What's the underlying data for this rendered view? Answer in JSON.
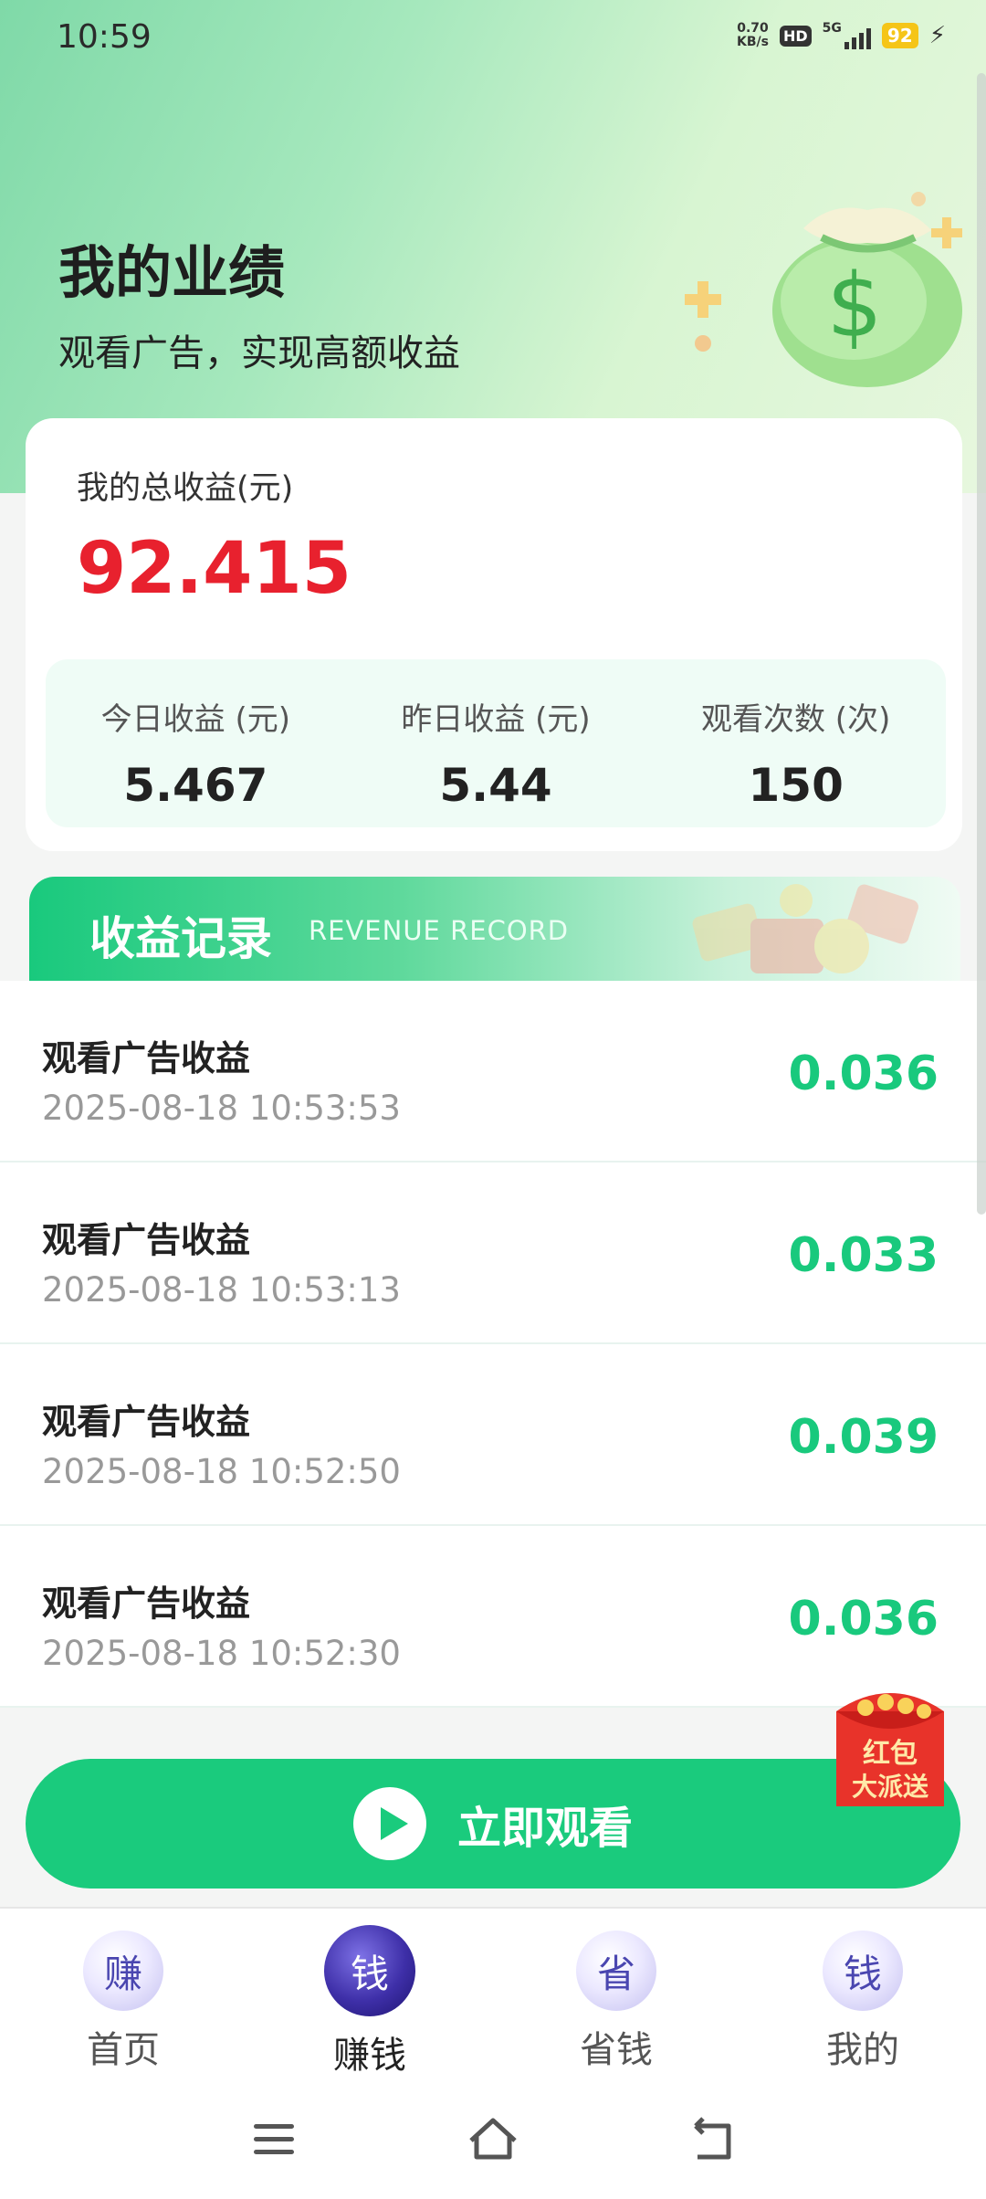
{
  "status_bar": {
    "time": "10:59",
    "net_speed_value": "0.70",
    "net_speed_unit": "KB/s",
    "hd": "HD",
    "network": "5G",
    "battery": "92"
  },
  "hero": {
    "title": "我的业绩",
    "subtitle": "观看广告，实现高额收益"
  },
  "summary": {
    "total_label": "我的总收益(元)",
    "total_value": "92.415",
    "stats": [
      {
        "label": "今日收益 (元)",
        "value": "5.467"
      },
      {
        "label": "昨日收益 (元)",
        "value": "5.44"
      },
      {
        "label": "观看次数 (次)",
        "value": "150"
      }
    ]
  },
  "records": {
    "title": "收益记录",
    "subtitle": "REVENUE RECORD",
    "items": [
      {
        "title": "观看广告收益",
        "time": "2025-08-18 10:53:53",
        "amount": "0.036"
      },
      {
        "title": "观看广告收益",
        "time": "2025-08-18 10:53:13",
        "amount": "0.033"
      },
      {
        "title": "观看广告收益",
        "time": "2025-08-18 10:52:50",
        "amount": "0.039"
      },
      {
        "title": "观看广告收益",
        "time": "2025-08-18 10:52:30",
        "amount": "0.036"
      }
    ]
  },
  "red_packet": {
    "line1": "红包",
    "line2": "大派送"
  },
  "watch_button": {
    "label": "立即观看"
  },
  "tabs": [
    {
      "icon_char": "赚",
      "label": "首页"
    },
    {
      "icon_char": "钱",
      "label": "赚钱"
    },
    {
      "icon_char": "省",
      "label": "省钱"
    },
    {
      "icon_char": "钱",
      "label": "我的"
    }
  ],
  "colors": {
    "accent_green": "#1acb7d",
    "total_red": "#e8212e",
    "active_tab": "#3e2fa8"
  }
}
